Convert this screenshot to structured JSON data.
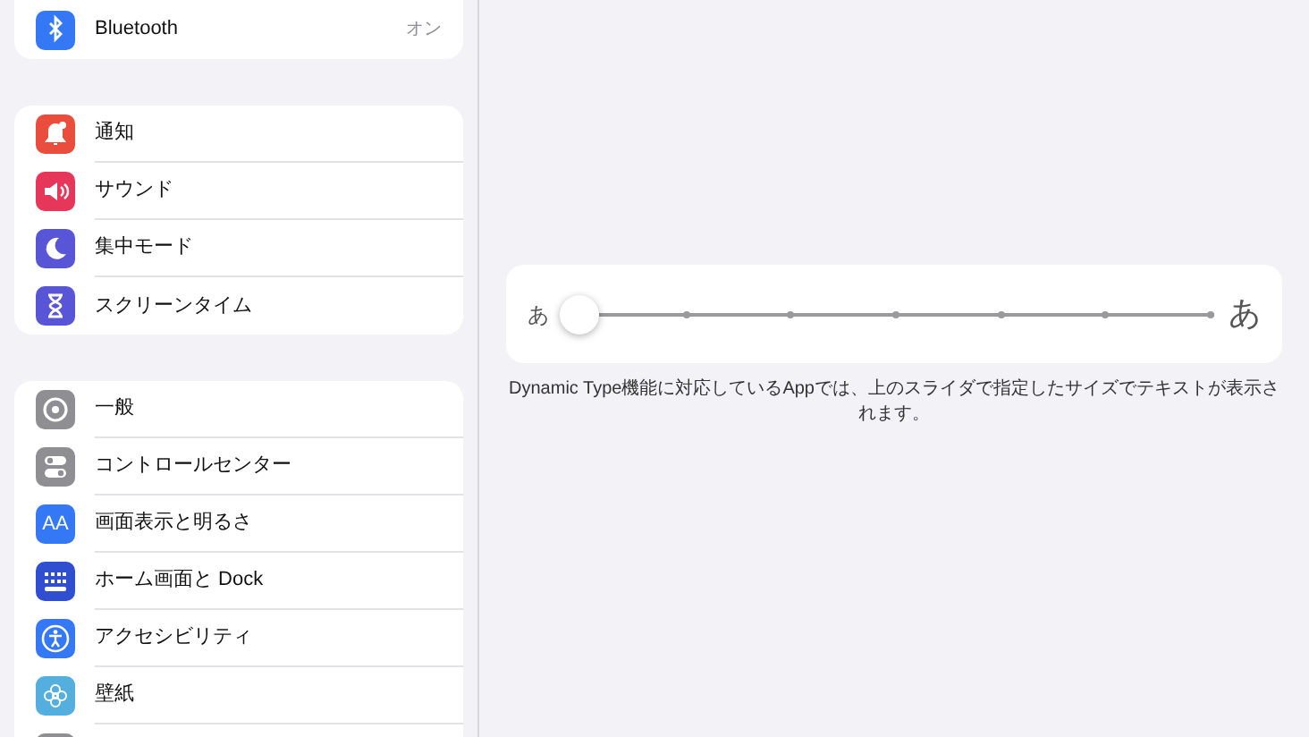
{
  "sidebar": {
    "groups": [
      {
        "items": [
          {
            "label": "Bluetooth",
            "value": "オン",
            "kind": "bluetooth",
            "color": "#3478f6"
          }
        ]
      },
      {
        "items": [
          {
            "label": "通知",
            "kind": "bell",
            "color": "#eb4d3d"
          },
          {
            "label": "サウンド",
            "kind": "speaker",
            "color": "#e6375a"
          },
          {
            "label": "集中モード",
            "kind": "moon",
            "color": "#5856d6"
          },
          {
            "label": "スクリーンタイム",
            "kind": "hourglass",
            "color": "#5856d6"
          }
        ]
      },
      {
        "items": [
          {
            "label": "一般",
            "kind": "gear",
            "color": "#8e8e93"
          },
          {
            "label": "コントロールセンター",
            "kind": "toggles",
            "color": "#8e8e93"
          },
          {
            "label": "画面表示と明るさ",
            "kind": "text",
            "icon_text": "AA",
            "color": "#3478f6"
          },
          {
            "label": "ホーム画面と Dock",
            "kind": "grid",
            "color": "#2f4fd0"
          },
          {
            "label": "アクセシビリティ",
            "kind": "accessibility",
            "color": "#3478f6"
          },
          {
            "label": "壁紙",
            "kind": "flower",
            "color": "#54aede"
          },
          {
            "kind": "blank",
            "color": "#8e8e93"
          }
        ]
      }
    ]
  },
  "text_size": {
    "small_label": "あ",
    "large_label": "あ",
    "level": 0,
    "caption": "Dynamic Type機能に対応しているAppでは、上のスライダで指定したサイズでテキストが表示されます。"
  }
}
